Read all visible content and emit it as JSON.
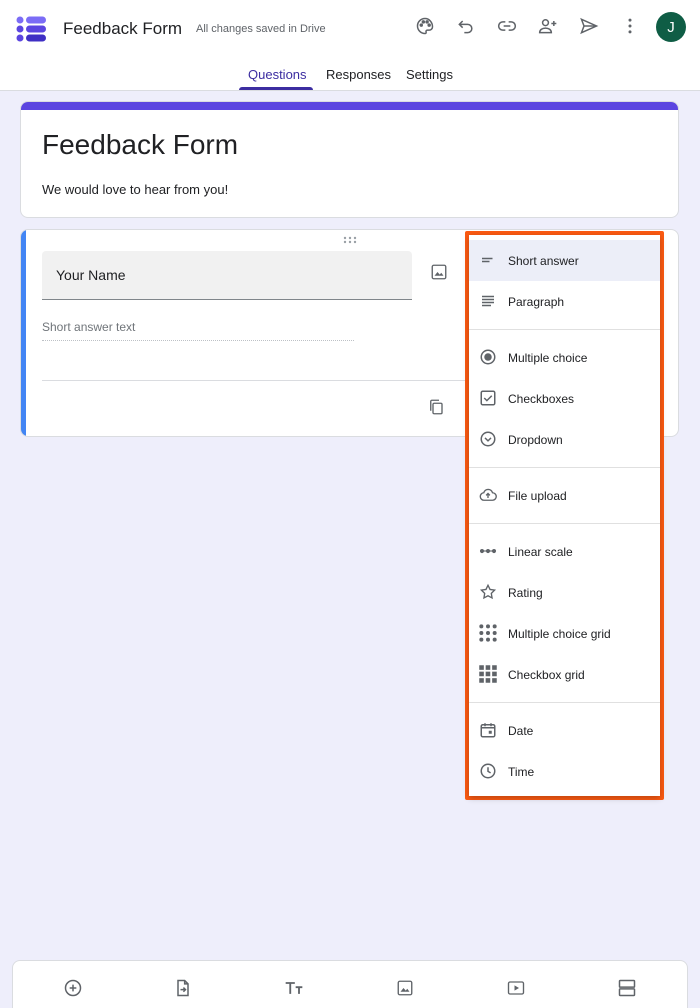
{
  "header": {
    "app_title": "Feedback Form",
    "save_status": "All changes saved in Drive",
    "avatar_letter": "J",
    "icons": [
      "palette-icon",
      "undo-icon",
      "link-icon",
      "add-collaborator-icon",
      "send-icon",
      "more-vert-icon"
    ]
  },
  "tabs": [
    {
      "label": "Questions",
      "active": true
    },
    {
      "label": "Responses",
      "active": false
    },
    {
      "label": "Settings",
      "active": false
    }
  ],
  "form": {
    "title": "Feedback Form",
    "description": "We would love to hear from you!"
  },
  "question": {
    "title": "Your Name",
    "answer_placeholder": "Short answer text"
  },
  "question_types": {
    "groups": [
      [
        {
          "label": "Short answer",
          "icon": "short-answer-icon",
          "selected": true
        },
        {
          "label": "Paragraph",
          "icon": "paragraph-icon"
        }
      ],
      [
        {
          "label": "Multiple choice",
          "icon": "radio-button-icon"
        },
        {
          "label": "Checkboxes",
          "icon": "checkbox-icon"
        },
        {
          "label": "Dropdown",
          "icon": "dropdown-circle-icon"
        }
      ],
      [
        {
          "label": "File upload",
          "icon": "cloud-upload-icon"
        }
      ],
      [
        {
          "label": "Linear scale",
          "icon": "linear-scale-icon"
        },
        {
          "label": "Rating",
          "icon": "star-icon"
        },
        {
          "label": "Multiple choice grid",
          "icon": "dot-grid-icon"
        },
        {
          "label": "Checkbox grid",
          "icon": "square-grid-icon"
        }
      ],
      [
        {
          "label": "Date",
          "icon": "calendar-icon"
        },
        {
          "label": "Time",
          "icon": "clock-icon"
        }
      ]
    ]
  },
  "bottom_toolbar": [
    "add-question-icon",
    "import-questions-icon",
    "add-title-icon",
    "add-image-icon",
    "add-video-icon",
    "add-section-icon"
  ],
  "colors": {
    "accent": "#5b45e0",
    "tab_active": "#3c2da1",
    "question_bar": "#4285f4",
    "highlight": "#fb5a12",
    "avatar": "#0f5d45",
    "background": "#eeeefb"
  }
}
